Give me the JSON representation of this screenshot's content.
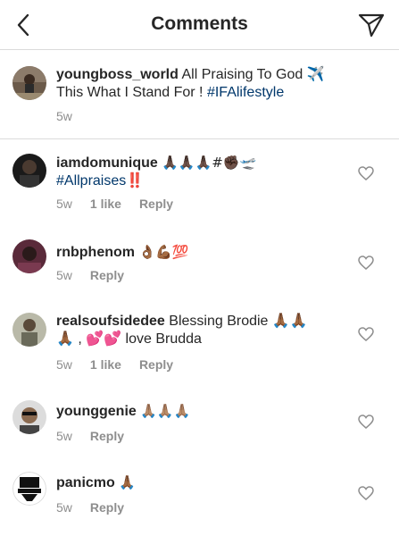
{
  "header": {
    "title": "Comments"
  },
  "caption": {
    "username": "youngboss_world",
    "text_line1": "All Praising To God ✈️",
    "text_line2": "This What I Stand For ! ",
    "hashtag": "#IFAlifestyle",
    "time": "5w"
  },
  "comments": [
    {
      "username": "iamdomunique",
      "text_line1": "🙏🏿🙏🏿🙏🏿#✊🏿🛫",
      "hashtag": "#Allpraises",
      "exclaim": "‼️",
      "time": "5w",
      "likes": "1 like",
      "reply": "Reply"
    },
    {
      "username": "rnbphenom",
      "text": "👌🏾💪🏾💯",
      "time": "5w",
      "reply": "Reply"
    },
    {
      "username": "realsoufsidedee",
      "text_line1": "Blessing Brodie 🙏🏾🙏🏾",
      "text_line2": "🙏🏾 , 💕💕 love Brudda",
      "time": "5w",
      "likes": "1 like",
      "reply": "Reply"
    },
    {
      "username": "younggenie",
      "text": "🙏🏽🙏🏽🙏🏽",
      "time": "5w",
      "reply": "Reply"
    },
    {
      "username": "panicmo",
      "text": "🙏🏾",
      "time": "5w",
      "reply": "Reply"
    }
  ],
  "colors": {
    "text": "#262626",
    "muted": "#8e8e8e",
    "hashtag": "#00376b",
    "divider": "#dbdbdb"
  },
  "icons": [
    "back-arrow-icon",
    "send-direct-icon",
    "heart-outline-icon"
  ]
}
